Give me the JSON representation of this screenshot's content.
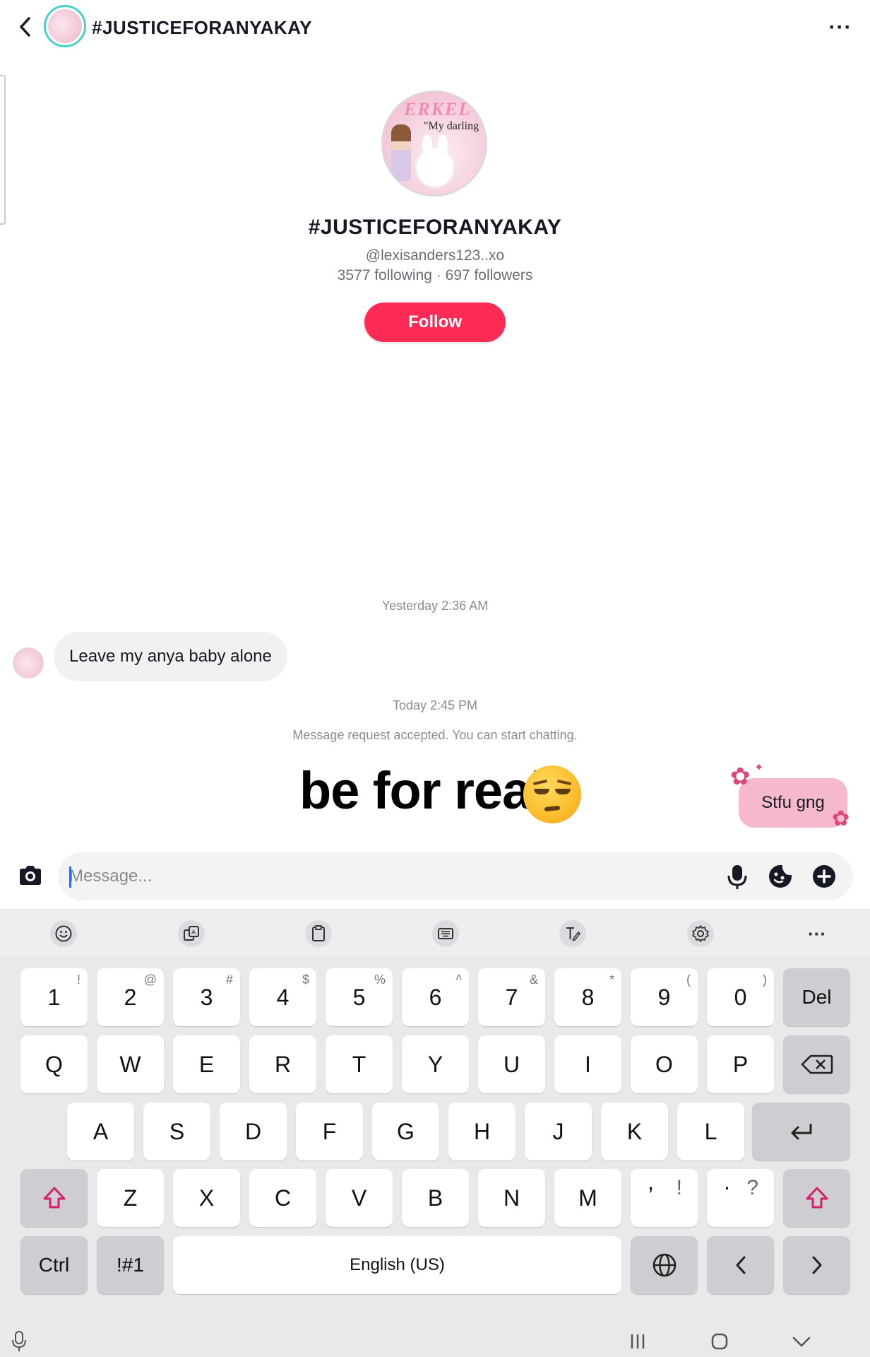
{
  "header": {
    "title": "#JUSTICEFORANYAKAY",
    "more_label": "···"
  },
  "profile": {
    "avatar_text_top": "ERKEL",
    "avatar_text": "\"My darling",
    "name": "#JUSTICEFORANYAKAY",
    "handle": "@lexisanders123..xo",
    "stats": "3577 following · 697 followers",
    "follow_label": "Follow",
    "follow_color": "#fe2c55"
  },
  "conversation": {
    "timestamp_1": "Yesterday 2:36 AM",
    "incoming_message": "Leave my anya baby alone",
    "timestamp_2": "Today 2:45 PM",
    "system_message": "Message request accepted. You can start chatting.",
    "caption": "be for real",
    "caption_emoji": "unamused-face",
    "outgoing_message": "Stfu gng",
    "outgoing_bubble_color": "#f6b9cc"
  },
  "composer": {
    "placeholder": "Message...",
    "value": ""
  },
  "keyboard": {
    "toolbar_icons": [
      "emoji-icon",
      "translate-icon",
      "clipboard-icon",
      "keyboard-mode-icon",
      "handwriting-icon",
      "settings-icon"
    ],
    "toolbar_more": "···",
    "row1": [
      {
        "key": "1",
        "sub": "!"
      },
      {
        "key": "2",
        "sub": "@"
      },
      {
        "key": "3",
        "sub": "#"
      },
      {
        "key": "4",
        "sub": "$"
      },
      {
        "key": "5",
        "sub": "%"
      },
      {
        "key": "6",
        "sub": "^"
      },
      {
        "key": "7",
        "sub": "&"
      },
      {
        "key": "8",
        "sub": "*"
      },
      {
        "key": "9",
        "sub": "("
      },
      {
        "key": "0",
        "sub": ")"
      }
    ],
    "del_label": "Del",
    "row2": [
      "Q",
      "W",
      "E",
      "R",
      "T",
      "Y",
      "U",
      "I",
      "O",
      "P"
    ],
    "row3": [
      "A",
      "S",
      "D",
      "F",
      "G",
      "H",
      "J",
      "K",
      "L"
    ],
    "row4": [
      "Z",
      "X",
      "C",
      "V",
      "B",
      "N",
      "M"
    ],
    "comma": {
      "key": ",",
      "sub": "!"
    },
    "period": {
      "key": ".",
      "sub": "?"
    },
    "ctrl_label": "Ctrl",
    "symbols_label": "!#1",
    "space_label": "English (US)"
  }
}
